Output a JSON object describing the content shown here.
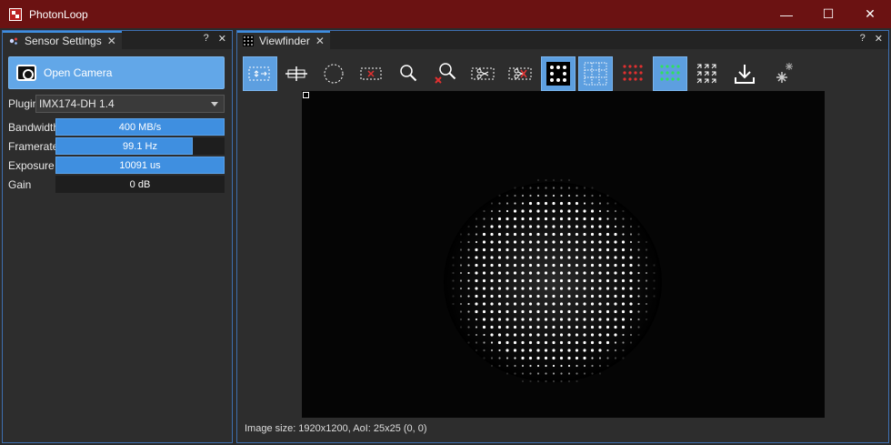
{
  "app": {
    "title": "PhotonLoop"
  },
  "window_controls": {
    "minimize": "—",
    "maximize": "☐",
    "close": "✕"
  },
  "sensor_panel": {
    "tab_label": "Sensor Settings",
    "help": "?",
    "close": "✕",
    "open_camera_label": "Open Camera",
    "plugin_label": "Plugin",
    "plugin_value": "IMX174-DH 1.4",
    "params": [
      {
        "label": "Bandwidth",
        "value": "400 MB/s",
        "level": 1.0
      },
      {
        "label": "Framerate",
        "value": "99.1 Hz",
        "level": 0.81
      },
      {
        "label": "Exposure",
        "value": "10091 us",
        "level": 1.0
      },
      {
        "label": "Gain",
        "value": "0 dB",
        "level": 0.0
      }
    ]
  },
  "viewfinder_panel": {
    "tab_label": "Viewfinder",
    "help": "?",
    "close": "✕",
    "toolbar": [
      {
        "icon": "select-aoi-icon",
        "active": true
      },
      {
        "icon": "crosshair-icon",
        "active": false
      },
      {
        "icon": "circle-select-icon",
        "active": false
      },
      {
        "icon": "delete-aoi-icon",
        "active": false
      },
      {
        "icon": "zoom-icon",
        "active": false
      },
      {
        "icon": "zoom-reset-icon",
        "active": false
      },
      {
        "icon": "cut-icon",
        "active": false
      },
      {
        "icon": "cut-remove-icon",
        "active": false
      },
      {
        "icon": "dot-grid-icon",
        "active": true
      },
      {
        "icon": "grid-icon",
        "active": true
      },
      {
        "icon": "red-dots-icon",
        "active": false
      },
      {
        "icon": "green-dots-icon",
        "active": true
      },
      {
        "icon": "arrow-field-icon",
        "active": false
      },
      {
        "icon": "download-icon",
        "active": false
      },
      {
        "icon": "settings-sparkle-icon",
        "active": false
      }
    ],
    "status_text": "Image size: 1920x1200, AoI: 25x25 (0, 0)"
  },
  "colors": {
    "titlebar": "#6b1212",
    "accent": "#3f8fe0",
    "dock_border": "#3e6fb0"
  }
}
